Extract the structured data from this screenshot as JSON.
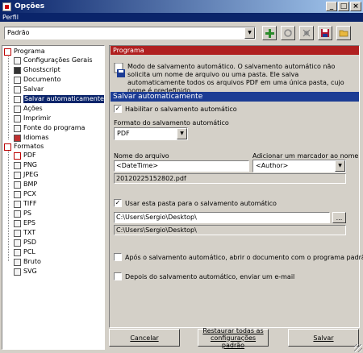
{
  "window": {
    "title": "Opções",
    "min": "_",
    "max": "□",
    "close": "×"
  },
  "profile": {
    "bar_label": "Perfil",
    "selected": "Padrão"
  },
  "toolbar": {
    "icons": [
      "add-icon",
      "refresh-icon",
      "settings-icon",
      "save-icon",
      "folder-icon"
    ]
  },
  "tree": {
    "program_group": "Programa",
    "program_items": [
      "Configurações Gerais",
      "Ghostscript",
      "Documento",
      "Salvar",
      "Salvar automaticamente",
      "Ações",
      "Imprimir",
      "Fonte do programa",
      "Idiomas"
    ],
    "formats_group": "Formatos",
    "format_items": [
      "PDF",
      "PNG",
      "JPEG",
      "BMP",
      "PCX",
      "TIFF",
      "PS",
      "EPS",
      "TXT",
      "PSD",
      "PCL",
      "Bruto",
      "SVG"
    ],
    "selected": "Salvar automaticamente"
  },
  "panel": {
    "header": "Programa",
    "description": "Modo de salvamento automático. O salvamento automático não solicita um nome de arquivo ou uma pasta. Ele salva automaticamente todos os arquivos PDF em uma única pasta, cujo nome é predefinido.",
    "section_title": "Salvar automaticamente",
    "enable_label": "Habilitar o salvamento automático",
    "format_label": "Formato do salvamento automático",
    "format_value": "PDF",
    "filename_label": "Nome do arquivo",
    "filename_value": "<DateTime>",
    "marker_label": "Adicionar um marcador ao nome de ar",
    "marker_value": "<Author>",
    "filename_preview": "20120225152802.pdf",
    "use_folder_label": "Usar esta pasta para o salvamento automático",
    "folder_value": "C:\\Users\\Sergio\\Desktop\\",
    "folder_browse": "...",
    "folder_preview": "C:\\Users\\Sergio\\Desktop\\",
    "open_after_label": "Após o salvamento automático, abrir o documento com o programa padrão.",
    "email_after_label": "Depois do salvamento automático, enviar um e-mail"
  },
  "buttons": {
    "cancel": "Cancelar",
    "restore_line1": "Restaurar todas as",
    "restore_line2": "configurações padrão",
    "save": "Salvar"
  }
}
